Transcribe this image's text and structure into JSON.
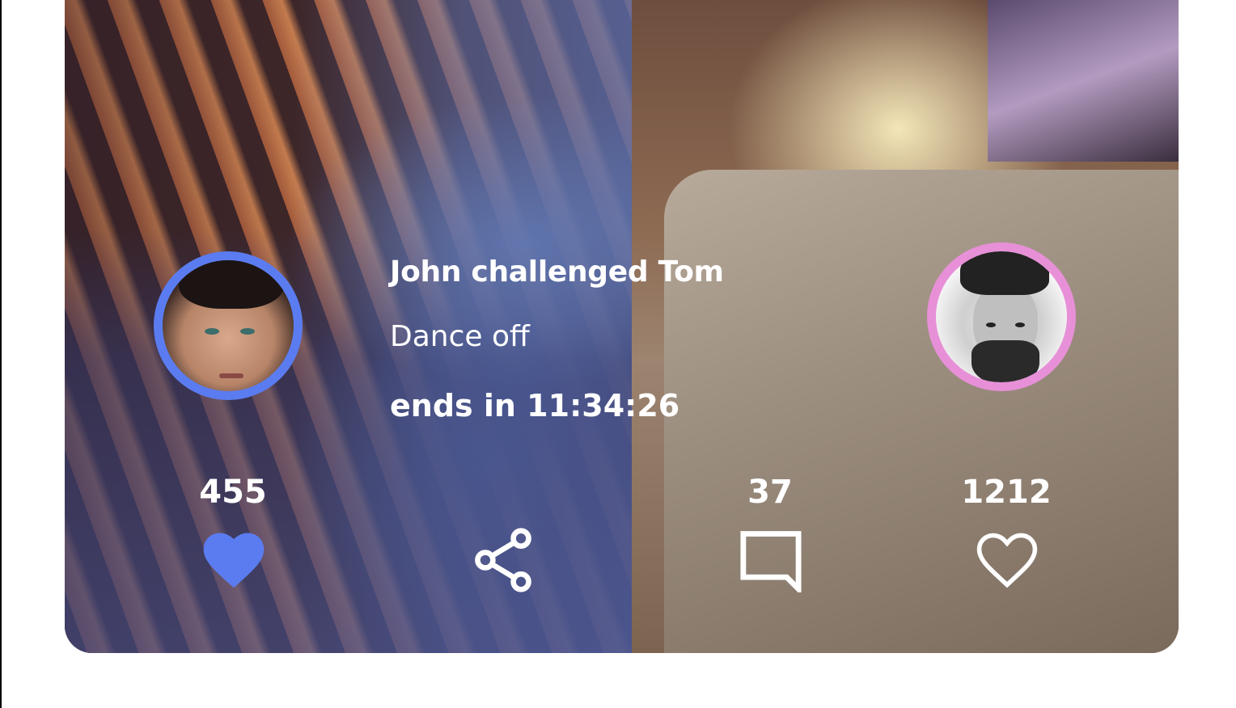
{
  "challenge": {
    "title": "John challenged Tom",
    "subtitle": "Dance off",
    "timer": "ends in 11:34:26"
  },
  "challenger": {
    "likes": "455",
    "ring_color": "#5b7cf0",
    "liked": true
  },
  "opponent": {
    "likes": "1212",
    "ring_color": "#e790d8",
    "liked": false
  },
  "comments": {
    "count": "37"
  },
  "icons": {
    "challenger_like": "heart-filled-icon",
    "share": "share-icon",
    "comment": "comment-icon",
    "opponent_like": "heart-outline-icon"
  },
  "colors": {
    "accent": "#5b7cf0",
    "opponent_accent": "#e790d8",
    "text": "#ffffff"
  }
}
